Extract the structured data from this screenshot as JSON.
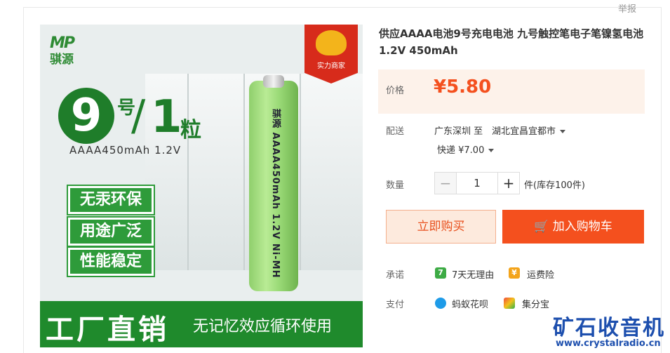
{
  "report_label": "举报",
  "product_image": {
    "brand_logo_latin": "MP",
    "brand_logo_cn": "骐源",
    "badge_text": "实力商家",
    "big_number": "9",
    "hao": "号",
    "slash": "/",
    "one": "1",
    "li": "粒",
    "spec": "AAAA450mAh 1.2V",
    "tags": [
      "无汞环保",
      "用途广泛",
      "性能稳定"
    ],
    "battery_text": "骐源 AAAA450mAh 1.2V Ni-MH",
    "footer_left": "工厂直销",
    "footer_right": "无记忆效应循环使用"
  },
  "title": "供应AAAA电池9号充电电池 九号触控笔电子笔镍氢电池1.2V 450mAh",
  "price": {
    "label": "价格",
    "value": "¥5.80"
  },
  "delivery": {
    "label": "配送",
    "from": "广东深圳 至",
    "to": "湖北宜昌宜都市",
    "shipping": "快递 ¥7.00"
  },
  "quantity": {
    "label": "数量",
    "minus": "−",
    "value": "1",
    "plus": "+",
    "stock": "件(库存100件)"
  },
  "buttons": {
    "buy_now": "立即购买",
    "add_to_cart": "加入购物车"
  },
  "promise": {
    "label": "承诺",
    "item1_icon": "7",
    "item1": "7天无理由",
    "item2": "运费险"
  },
  "payment": {
    "label": "支付",
    "item1": "蚂蚁花呗",
    "item2": "集分宝"
  },
  "watermark": {
    "cn": "矿石收音机",
    "url": "www.crystalradio.cn"
  },
  "colors": {
    "accent": "#f4501e",
    "price_bg": "#fdf2ea",
    "brand_green": "#1f8a2c",
    "watermark": "#1d4fae"
  }
}
